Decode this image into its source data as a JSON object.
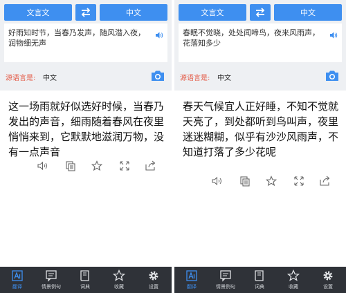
{
  "panels": [
    {
      "source_lang_button": "文言文",
      "target_lang_button": "中文",
      "input_text": "好雨知时节，当春乃发声，随风潜入夜，润物细无声",
      "source_label": "源语言是:",
      "source_value": "中文",
      "result_text": "这一场雨就好似选好时候，当春乃发出的声音，细雨随着春风在夜里悄悄来到，它默默地滋润万物，没有一点声音"
    },
    {
      "source_lang_button": "文言文",
      "target_lang_button": "中文",
      "input_text": "春眠不觉晓，处处闻啼鸟，夜来风雨声，花落知多少",
      "source_label": "源语言是:",
      "source_value": "中文",
      "result_text": "春天气候宜人正好睡，不知不觉就天亮了，到处都听到鸟叫声，夜里迷迷糊糊，似乎有沙沙风雨声，不知道打落了多少花呢"
    }
  ],
  "tabs": [
    "翻译",
    "情景例句",
    "词典",
    "收藏",
    "设置"
  ],
  "colors": {
    "accent": "#3e8ff0",
    "source_label": "#e45a46",
    "tabbar": "#2f3238"
  }
}
